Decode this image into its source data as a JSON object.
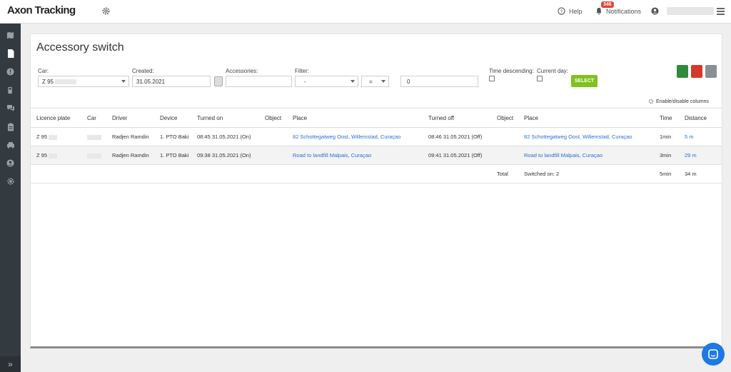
{
  "app": {
    "logo": "Axon Tracking"
  },
  "topbar": {
    "help_label": "Help",
    "notifications_label": "Notifications",
    "notifications_count": "346"
  },
  "sidebar": {
    "icons": [
      "map-icon",
      "document-icon",
      "alert-icon",
      "fuel-icon",
      "chat-icon",
      "clipboard-icon",
      "car-icon",
      "user-icon",
      "gear-icon"
    ],
    "expand_icon": "»"
  },
  "page": {
    "title": "Accessory switch"
  },
  "filters": {
    "car_label": "Car:",
    "car_value": "Z 95",
    "created_label": "Created:",
    "created_value": "31.05.2021",
    "accessories_label": "Accessories:",
    "accessories_value": "",
    "filter_label": "Filter:",
    "filter_value": "-",
    "operator_value": "=",
    "filter_input_value": "0",
    "time_desc_label": "Time descending:",
    "current_day_label": "Current day:",
    "select_label": "SELECT",
    "enable_columns_label": "Enable/disable columns"
  },
  "table": {
    "headers": [
      "Licence plate",
      "Car",
      "Driver",
      "Device",
      "Turned on",
      "Object",
      "Place",
      "Turned off",
      "Object",
      "Place",
      "Time",
      "Distance"
    ],
    "rows": [
      {
        "plate": "Z 95",
        "car": "",
        "driver": "Radjen Ramdin",
        "device": "1. PTO Baki",
        "turned_on": "08:45 31.05.2021 (On)",
        "object_on": "",
        "place_on": "82 Schottegatweg Oost, Willemstad, Curaçao",
        "turned_off": "08:46 31.05.2021 (Off)",
        "object_off": "",
        "place_off": "82 Schottegatweg Oost, Willemstad, Curaçao",
        "time": "1min",
        "distance": "5 m"
      },
      {
        "plate": "Z 95",
        "car": "",
        "driver": "Radjen Ramdin",
        "device": "1. PTO Baki",
        "turned_on": "09:38 31.05.2021 (On)",
        "object_on": "",
        "place_on": "Road to landfill Malpais, Curaçao",
        "turned_off": "09:41 31.05.2021 (Off)",
        "object_off": "",
        "place_off": "Road to landfill Malpais, Curaçao",
        "time": "3min",
        "distance": "29 m"
      }
    ],
    "total": {
      "label": "Total",
      "switched": "Switched on: 2",
      "time": "5min",
      "distance": "34 m"
    }
  },
  "colors": {
    "accent": "#7fc31c",
    "link": "#2a6fce",
    "sidebar": "#333a40",
    "badge": "#e0443c",
    "chat": "#1e78e5"
  }
}
